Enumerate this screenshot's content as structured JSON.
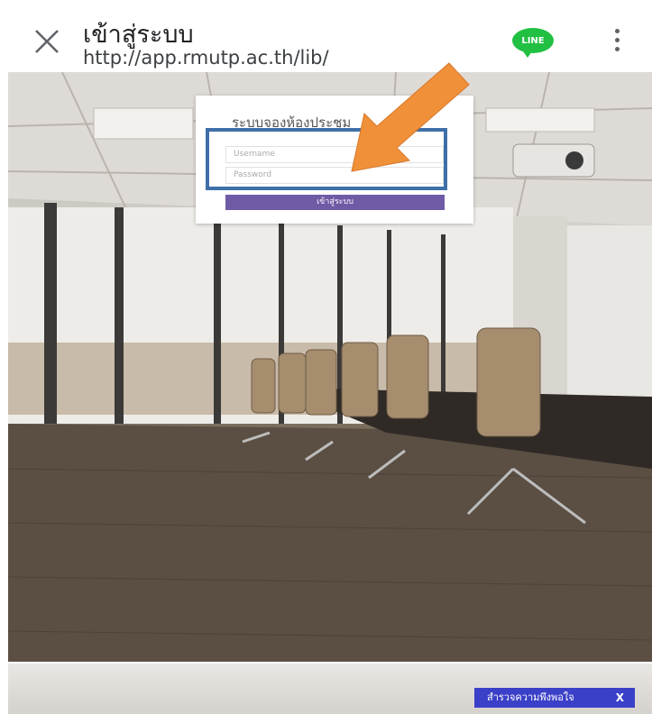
{
  "browser": {
    "title": "เข้าสู่ระบบ",
    "url": "http://app.rmutp.ac.th/lib/",
    "share_badge": "LINE",
    "close_icon": "close-icon",
    "menu_icon": "kebab-menu-icon"
  },
  "login_card": {
    "title": "ระบบจองห้องประชุม",
    "username_placeholder": "Username",
    "password_placeholder": "Password",
    "submit_label": "เข้าสู่ระบบ"
  },
  "survey": {
    "label": "สำรวจความพึงพอใจ",
    "close_label": "X"
  },
  "colors": {
    "brand_button": "#6f5aa6",
    "line_green": "#21c043",
    "highlight_box": "#3e6fa8",
    "annotation_arrow": "#f0913a",
    "survey_pill": "#3b40c8"
  }
}
